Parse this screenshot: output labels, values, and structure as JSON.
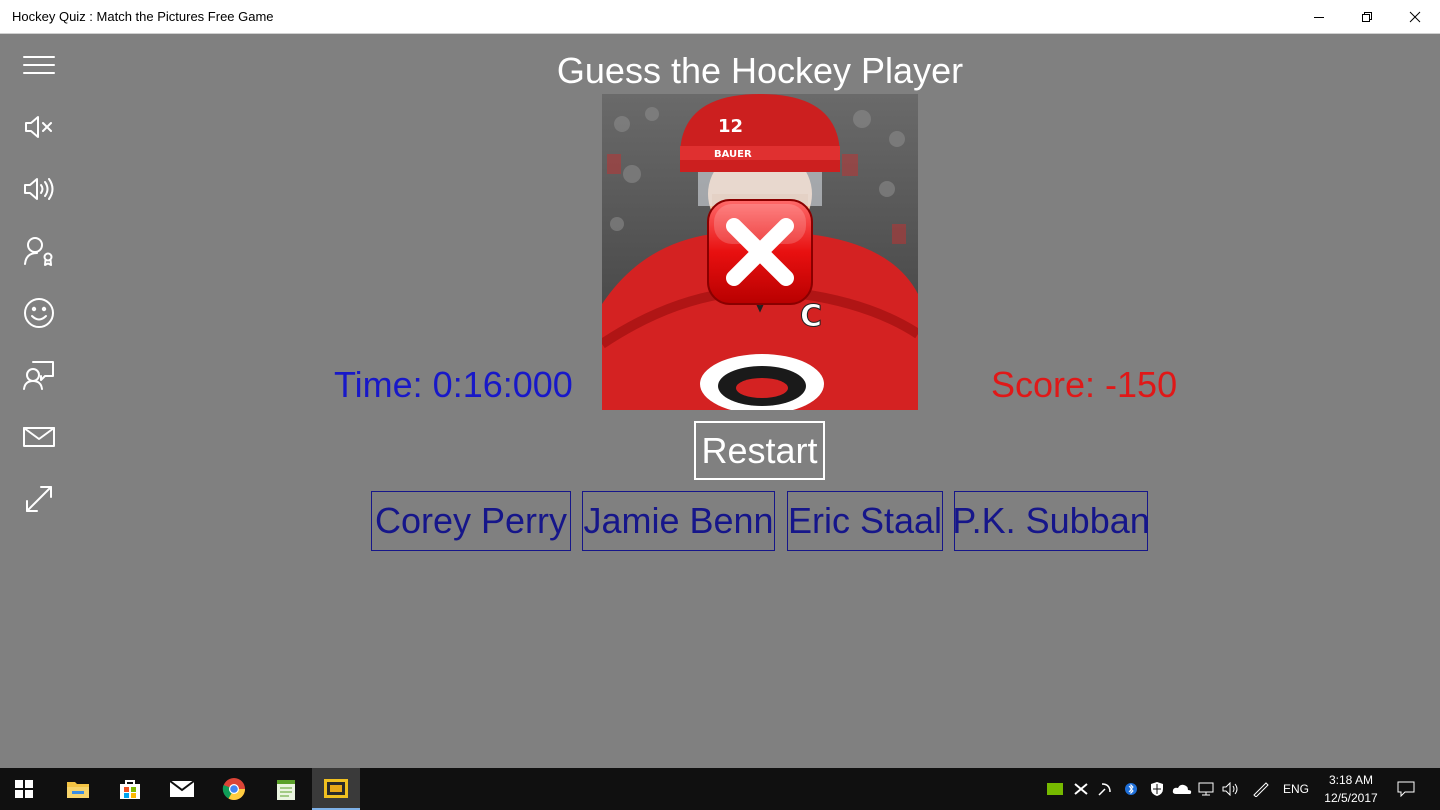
{
  "window": {
    "title": "Hockey Quiz : Match the Pictures Free Game",
    "minimize_icon": "minimize-icon",
    "restore_icon": "restore-icon",
    "close_icon": "close-icon"
  },
  "sidebar": {
    "items": [
      {
        "icon": "hamburger-menu-icon"
      },
      {
        "icon": "mute-icon"
      },
      {
        "icon": "volume-icon"
      },
      {
        "icon": "leaderboard-user-icon"
      },
      {
        "icon": "smiley-icon"
      },
      {
        "icon": "feedback-icon"
      },
      {
        "icon": "mail-icon"
      },
      {
        "icon": "fullscreen-icon"
      }
    ]
  },
  "game": {
    "heading": "Guess the Hockey Player",
    "photo_icon": "hockey-player-photo",
    "wrong_icon": "wrong-answer-x-icon",
    "time_label": "Time: 0:16:000",
    "score_label": "Score: -150",
    "restart_label": "Restart",
    "answers": [
      "Corey Perry",
      "Jamie Benn",
      "Eric Staal",
      "P.K. Subban"
    ],
    "colors": {
      "time": "#1818c8",
      "score": "#e01818",
      "answer": "#16168a",
      "background": "#808080"
    }
  },
  "taskbar": {
    "apps": [
      "start-icon",
      "file-explorer-icon",
      "store-icon",
      "mail-icon",
      "chrome-icon",
      "notepad-icon",
      "hockey-quiz-icon"
    ],
    "language": "ENG",
    "time": "3:18 AM",
    "date": "12/5/2017"
  }
}
